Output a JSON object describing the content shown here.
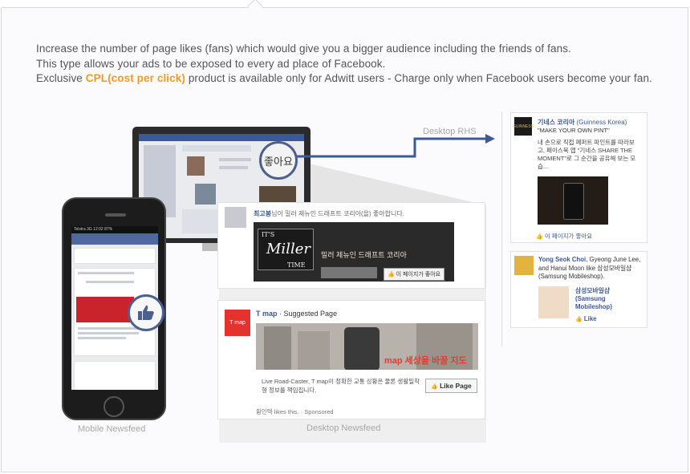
{
  "intro": {
    "line1": "Increase the number of page likes (fans) which would give you a bigger audience including the friends of fans.",
    "line2": "This type allows your ads to be exposed to every ad place of Facebook.",
    "line3_pre": "Exclusive ",
    "line3_highlight": "CPL(cost per click)",
    "line3_post": " product is available only for Adwitt users - Charge only when Facebook users become your fan."
  },
  "captions": {
    "desktop_rhs": "Desktop RHS",
    "mobile_newsfeed": "Mobile Newsfeed",
    "desktop_newsfeed": "Desktop Newsfeed"
  },
  "like_bubble": "좋아요",
  "newsfeed_card1": {
    "headline_name": "최고봉",
    "headline_rest": "님이 밀러 제뉴인 드래프트 코리아(을) 좋아합니다.",
    "banner_brand_top": "IT'S",
    "banner_brand": "Miller",
    "banner_brand_bottom": "TIME",
    "banner_title": "밀러 제뉴인 드래프트 코리아",
    "like_button": "이 페이지가 좋아요"
  },
  "newsfeed_card2": {
    "logo": "T map",
    "page_name": "T map",
    "page_suffix": " · Suggested Page",
    "overlay_brand": "map 세상을 바꿀 지도",
    "description": "Live Road-Caster, T map이 정확한 교통 상황은 물론 생활밀착형 정보를 책임집니다.",
    "like_button": "Like Page",
    "footer": "황인택 likes this. · Sponsored"
  },
  "rhs_card1": {
    "logo": "GUINNESS",
    "title": "기네스 코리아",
    "title_en": "(Guinness Korea)",
    "slogan": "\"MAKE YOUR OWN PINT\"",
    "description": "내 손으로 직접 페퍼트 파인트를 따라보고, 페이스북 앱 \"기네스 SHARE THE MOMENT\"로 그 순간을 공유해 보는 모습...",
    "like": "이 페이지가 좋아요"
  },
  "rhs_card2": {
    "who_names": "Yong Seok Choi",
    "who_rest": ", Gyeong June Lee, and Hanui Moon like 삼성모바일샵 (Samsung Mobileshop).",
    "page_name": "삼성모바일샵 (Samsung Mobileshop)",
    "like": "Like"
  },
  "phone": {
    "status": "Telstra 3G  12:02  87%"
  },
  "colors": {
    "facebook_blue": "#3b5998",
    "highlight_orange": "#f39a1c",
    "arrow_blue": "#3c5a99"
  }
}
